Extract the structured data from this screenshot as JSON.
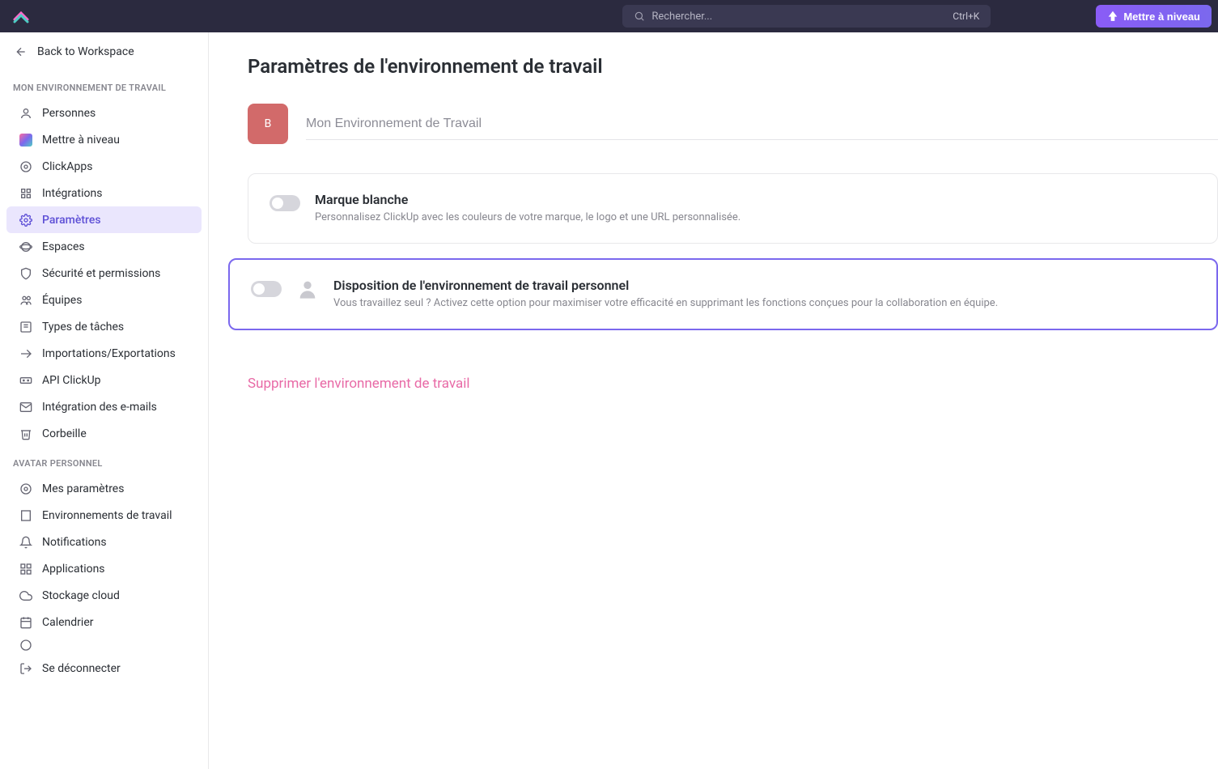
{
  "topbar": {
    "search_placeholder": "Rechercher...",
    "search_shortcut": "Ctrl+K",
    "upgrade_label": "Mettre à niveau"
  },
  "sidebar": {
    "back_label": "Back to Workspace",
    "section1_label": "MON ENVIRONNEMENT DE TRAVAIL",
    "items1": {
      "people": "Personnes",
      "upgrade": "Mettre à niveau",
      "clickapps": "ClickApps",
      "integrations": "Intégrations",
      "settings": "Paramètres",
      "spaces": "Espaces",
      "security": "Sécurité et permissions",
      "teams": "Équipes",
      "tasktypes": "Types de tâches",
      "importexport": "Importations/Exportations",
      "api": "API ClickUp",
      "email": "Intégration des e-mails",
      "trash": "Corbeille"
    },
    "section2_label": "AVATAR PERSONNEL",
    "items2": {
      "mysettings": "Mes paramètres",
      "workspaces": "Environnements de travail",
      "notifications": "Notifications",
      "apps": "Applications",
      "cloud": "Stockage cloud",
      "calendar": "Calendrier",
      "logout": "Se déconnecter"
    }
  },
  "main": {
    "page_title": "Paramètres de l'environnement de travail",
    "ws_avatar_letter": "B",
    "ws_name": "Mon Environnement de Travail",
    "whitelabel_title": "Marque blanche",
    "whitelabel_desc": "Personnalisez ClickUp avec les couleurs de votre marque, le logo et une URL personnalisée.",
    "personal_title": "Disposition de l'environnement de travail personnel",
    "personal_desc": "Vous travaillez seul ? Activez cette option pour maximiser votre efficacité en supprimant les fonctions conçues pour la collaboration en équipe.",
    "delete_label": "Supprimer l'environnement de travail"
  }
}
